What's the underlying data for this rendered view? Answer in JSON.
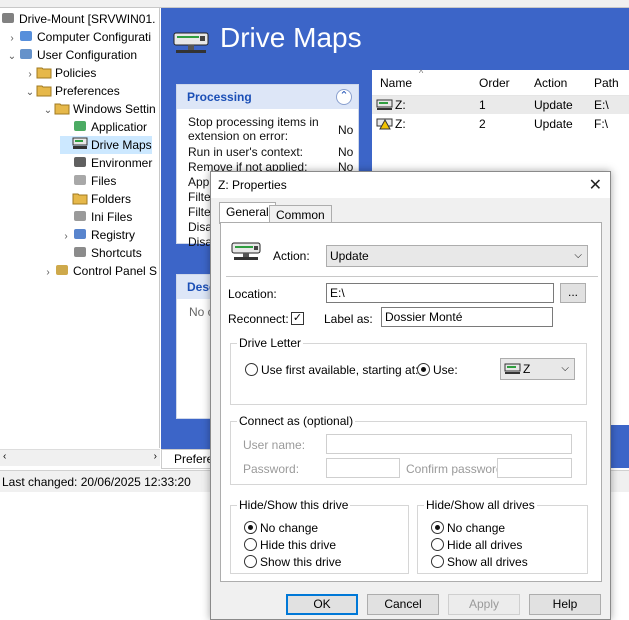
{
  "tree": {
    "items": [
      {
        "label": "Drive-Mount [SRVWIN01.",
        "icon": "gpo-icon",
        "indent": 0,
        "expander": "",
        "selected": false
      },
      {
        "label": "Computer Configurati",
        "icon": "computer-icon",
        "indent": 1,
        "expander": "›",
        "selected": false
      },
      {
        "label": "User Configuration",
        "icon": "user-icon",
        "indent": 1,
        "expander": "⌄",
        "selected": false
      },
      {
        "label": "Policies",
        "icon": "folder-icon",
        "indent": 2,
        "expander": "›",
        "selected": false
      },
      {
        "label": "Preferences",
        "icon": "folder-icon",
        "indent": 2,
        "expander": "⌄",
        "selected": false
      },
      {
        "label": "Windows Settin",
        "icon": "folder-icon",
        "indent": 3,
        "expander": "⌄",
        "selected": false
      },
      {
        "label": "Applicatior",
        "icon": "applications-icon",
        "indent": 4,
        "expander": "",
        "selected": false
      },
      {
        "label": "Drive Maps",
        "icon": "drive-map-icon",
        "indent": 4,
        "expander": "",
        "selected": true
      },
      {
        "label": "Environmer",
        "icon": "environment-icon",
        "indent": 4,
        "expander": "",
        "selected": false
      },
      {
        "label": "Files",
        "icon": "files-icon",
        "indent": 4,
        "expander": "",
        "selected": false
      },
      {
        "label": "Folders",
        "icon": "folder-icon",
        "indent": 4,
        "expander": "",
        "selected": false
      },
      {
        "label": "Ini Files",
        "icon": "ini-file-icon",
        "indent": 4,
        "expander": "",
        "selected": false
      },
      {
        "label": "Registry",
        "icon": "registry-icon",
        "indent": 4,
        "expander": "›",
        "selected": false
      },
      {
        "label": "Shortcuts",
        "icon": "shortcut-icon",
        "indent": 4,
        "expander": "",
        "selected": false
      },
      {
        "label": "Control Panel S",
        "icon": "control-panel-icon",
        "indent": 3,
        "expander": "›",
        "selected": false
      }
    ]
  },
  "status": {
    "last_changed": "Last changed: 20/06/2025 12:33:20"
  },
  "main": {
    "title": "Drive Maps",
    "processing": {
      "heading": "Processing",
      "rows": [
        {
          "label": "Stop processing items in extension on error:",
          "value": "No"
        },
        {
          "label": "Run in user's context:",
          "value": "No"
        },
        {
          "label": "Remove if not applied:",
          "value": "No"
        },
        {
          "label": "App",
          "value": ""
        },
        {
          "label": "Filte",
          "value": ""
        },
        {
          "label": "Filte",
          "value": ""
        },
        {
          "label": "Disa",
          "value": ""
        },
        {
          "label": "Disa",
          "value": ""
        }
      ]
    },
    "description": {
      "heading": "Desc",
      "body": "No c"
    },
    "bottom_tab": "Prefere",
    "list": {
      "columns": [
        "Name",
        "Order",
        "Action",
        "Path"
      ],
      "rows": [
        {
          "name": "Z:",
          "order": "1",
          "action": "Update",
          "path": "E:\\"
        },
        {
          "name": "Z:",
          "order": "2",
          "action": "Update",
          "path": "F:\\"
        }
      ]
    }
  },
  "dialog": {
    "title": "Z: Properties",
    "tabs": [
      "General",
      "Common"
    ],
    "action_label": "Action:",
    "action_value": "Update",
    "location_label": "Location:",
    "location_value": "E:\\",
    "browse_label": "...",
    "reconnect_label": "Reconnect:",
    "reconnect_checked": true,
    "label_as_label": "Label as:",
    "label_as_value": "Dossier Monté",
    "drive_letter": {
      "group": "Drive Letter",
      "first_available": "Use first available, starting at:",
      "use": "Use:",
      "selected": "use",
      "letter": "Z"
    },
    "connect_as": {
      "group": "Connect as (optional)",
      "user_name": "User name:",
      "password": "Password:",
      "confirm_password": "Confirm password:"
    },
    "hide_this": {
      "group": "Hide/Show this drive",
      "options": [
        "No change",
        "Hide this drive",
        "Show this drive"
      ],
      "selected": 0
    },
    "hide_all": {
      "group": "Hide/Show all drives",
      "options": [
        "No change",
        "Hide all drives",
        "Show all drives"
      ],
      "selected": 0
    },
    "buttons": {
      "ok": "OK",
      "cancel": "Cancel",
      "apply": "Apply",
      "help": "Help"
    }
  },
  "colors": {
    "accent_blue": "#3c65c8",
    "panel_header": "#1b4fb6",
    "selection": "#cce8ff"
  }
}
